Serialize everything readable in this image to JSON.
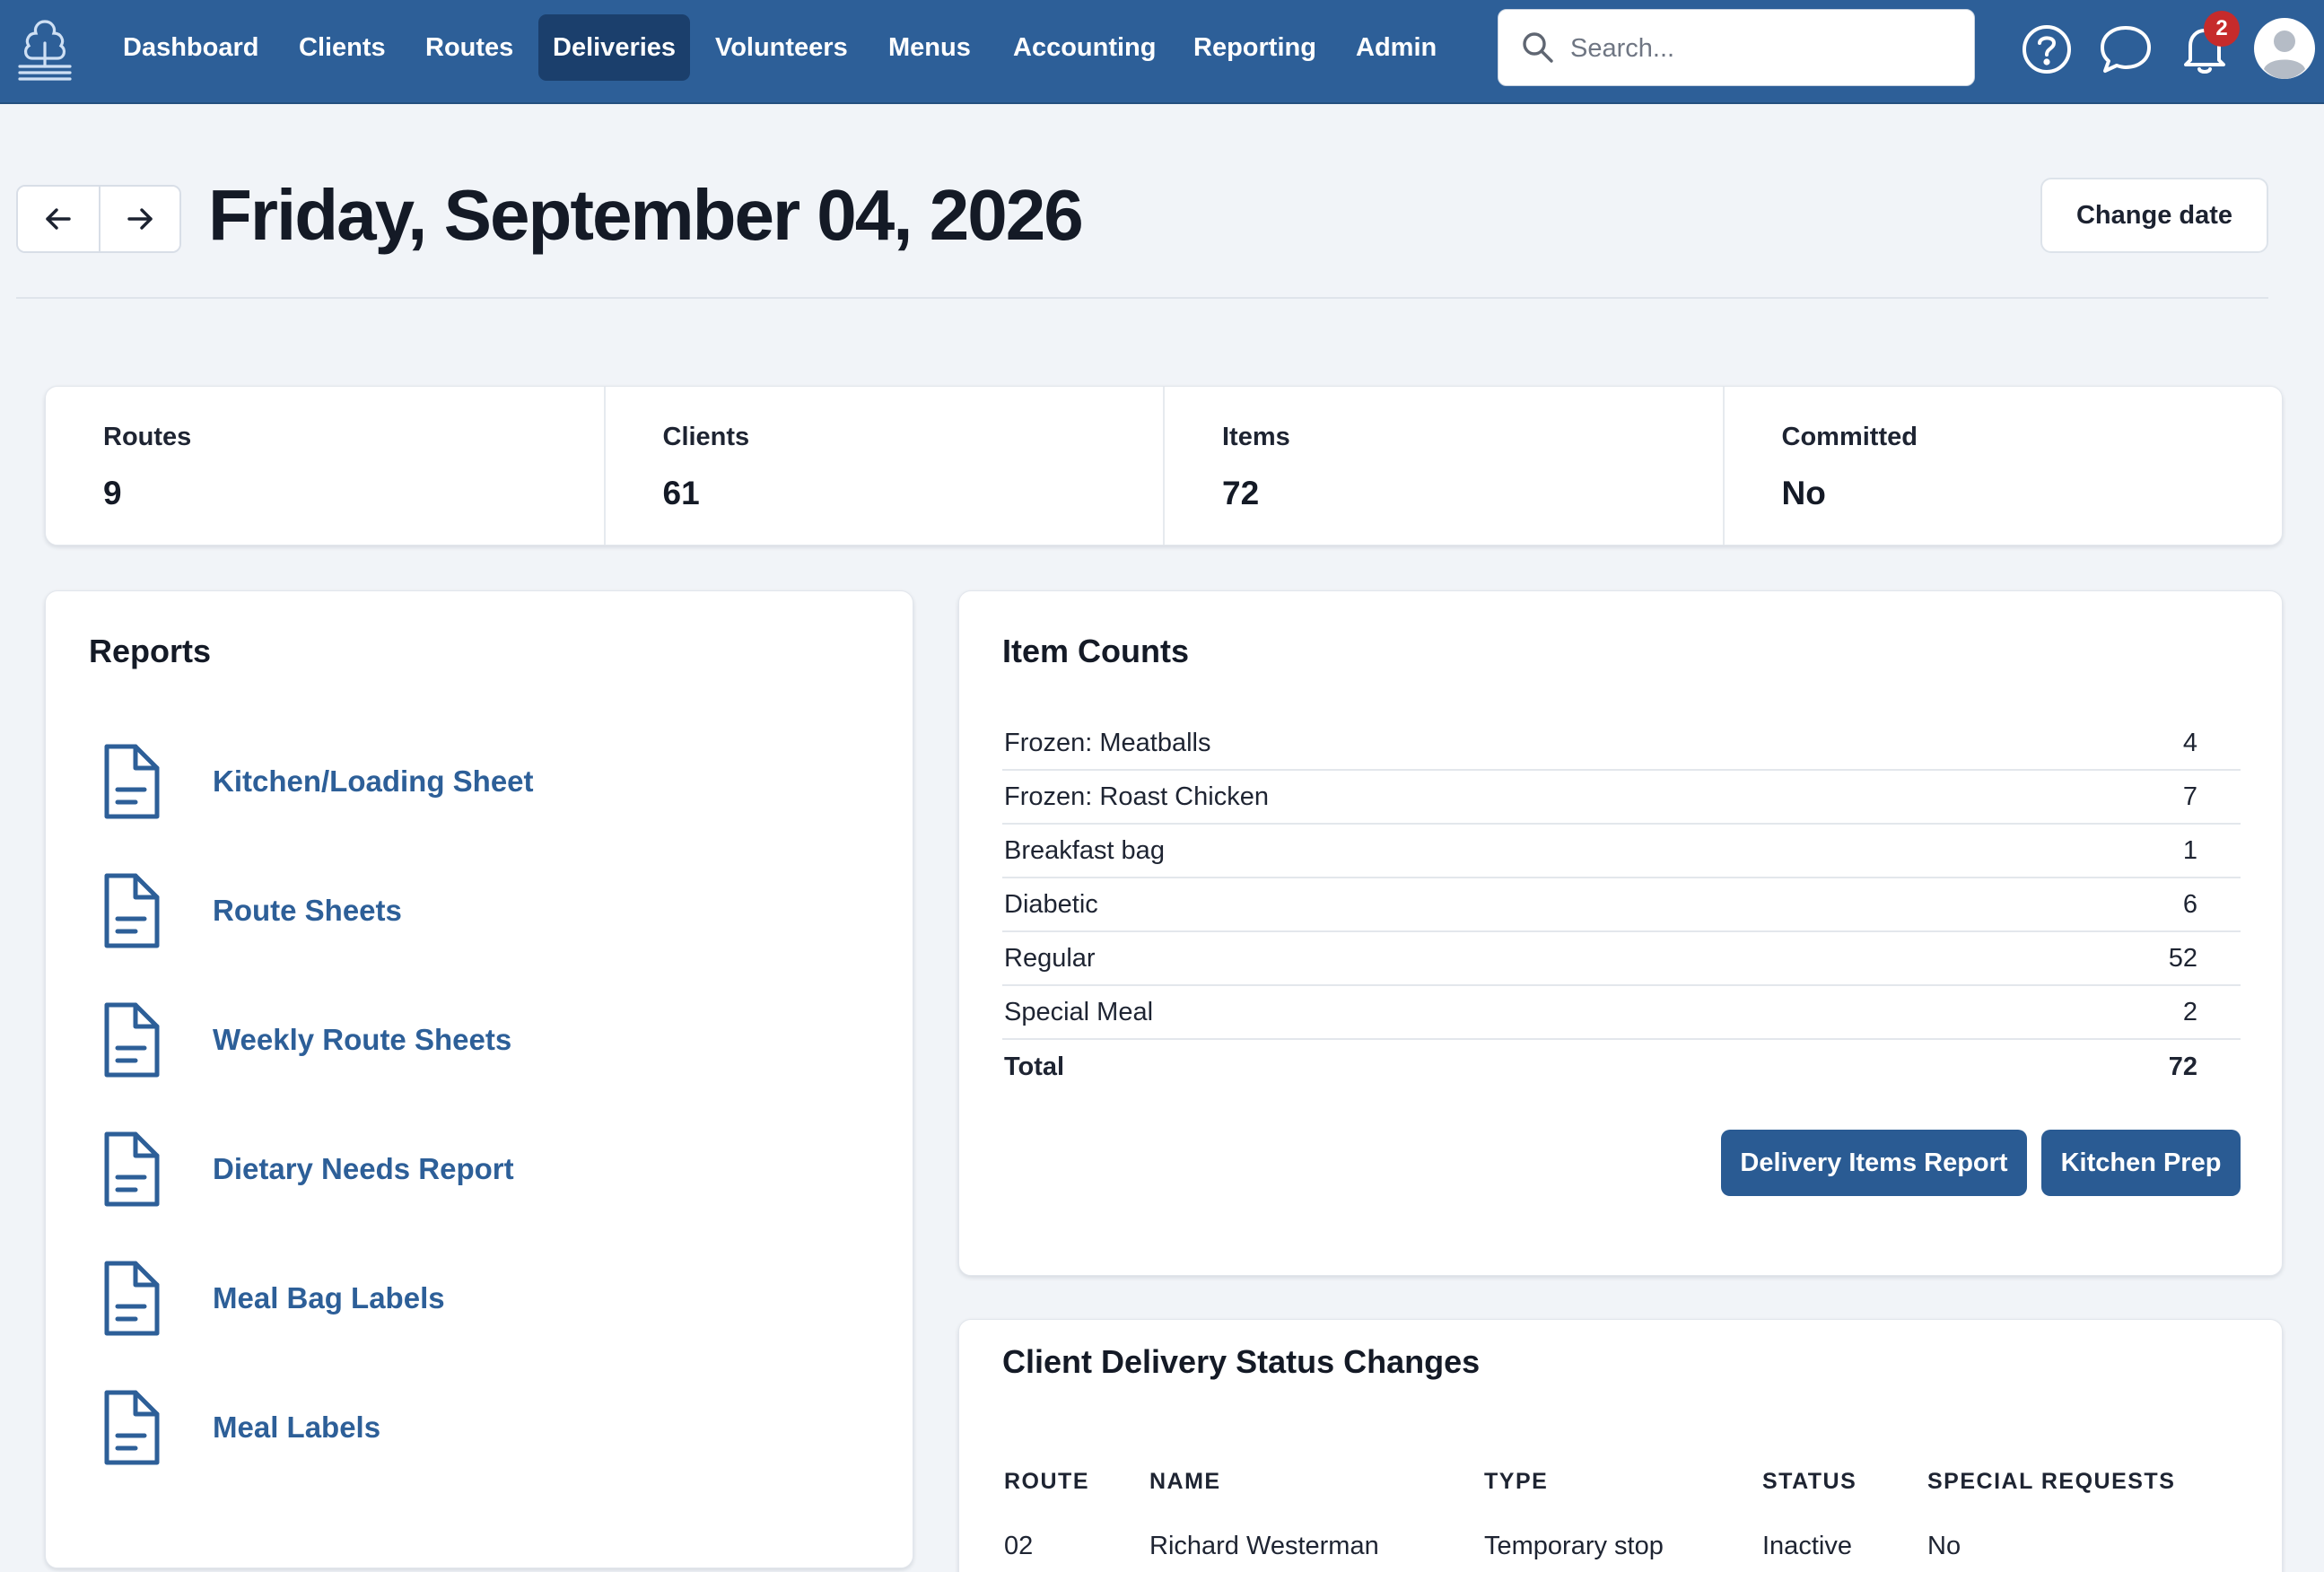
{
  "nav": {
    "items": [
      {
        "label": "Dashboard"
      },
      {
        "label": "Clients"
      },
      {
        "label": "Routes"
      },
      {
        "label": "Deliveries",
        "active": true
      },
      {
        "label": "Volunteers"
      },
      {
        "label": "Menus"
      },
      {
        "label": "Accounting"
      },
      {
        "label": "Reporting"
      },
      {
        "label": "Admin"
      }
    ],
    "search_placeholder": "Search...",
    "notification_count": "2",
    "icons": [
      "app-logo-icon",
      "search-icon",
      "help-icon",
      "chat-icon",
      "bell-icon",
      "avatar-icon"
    ],
    "colors": {
      "navbar": "#2d5f98",
      "active_tab": "#1b3f6c",
      "badge": "#c62b2b"
    }
  },
  "header": {
    "title": "Friday, September 04, 2026",
    "change_date_label": "Change date",
    "prev_icon": "arrow-left-icon",
    "next_icon": "arrow-right-icon"
  },
  "stats": [
    {
      "label": "Routes",
      "value": "9"
    },
    {
      "label": "Clients",
      "value": "61"
    },
    {
      "label": "Items",
      "value": "72"
    },
    {
      "label": "Committed",
      "value": "No"
    }
  ],
  "reports": {
    "title": "Reports",
    "items": [
      {
        "label": "Kitchen/Loading Sheet",
        "icon": "document-icon"
      },
      {
        "label": "Route Sheets",
        "icon": "document-icon"
      },
      {
        "label": "Weekly Route Sheets",
        "icon": "document-icon"
      },
      {
        "label": "Dietary Needs Report",
        "icon": "document-icon"
      },
      {
        "label": "Meal Bag Labels",
        "icon": "document-icon"
      },
      {
        "label": "Meal Labels",
        "icon": "document-icon"
      }
    ]
  },
  "item_counts": {
    "title": "Item Counts",
    "rows": [
      {
        "name": "Frozen: Meatballs",
        "count": "4"
      },
      {
        "name": "Frozen: Roast Chicken",
        "count": "7"
      },
      {
        "name": "Breakfast bag",
        "count": "1"
      },
      {
        "name": "Diabetic",
        "count": "6"
      },
      {
        "name": "Regular",
        "count": "52"
      },
      {
        "name": "Special Meal",
        "count": "2"
      }
    ],
    "total_label": "Total",
    "total_value": "72",
    "buttons": {
      "delivery_items_report": "Delivery Items Report",
      "kitchen_prep": "Kitchen Prep"
    }
  },
  "status_changes": {
    "title": "Client Delivery Status Changes",
    "columns": [
      "ROUTE",
      "NAME",
      "TYPE",
      "STATUS",
      "SPECIAL REQUESTS"
    ],
    "rows": [
      [
        "02",
        "Richard Westerman",
        "Temporary stop",
        "Inactive",
        "No"
      ]
    ]
  }
}
